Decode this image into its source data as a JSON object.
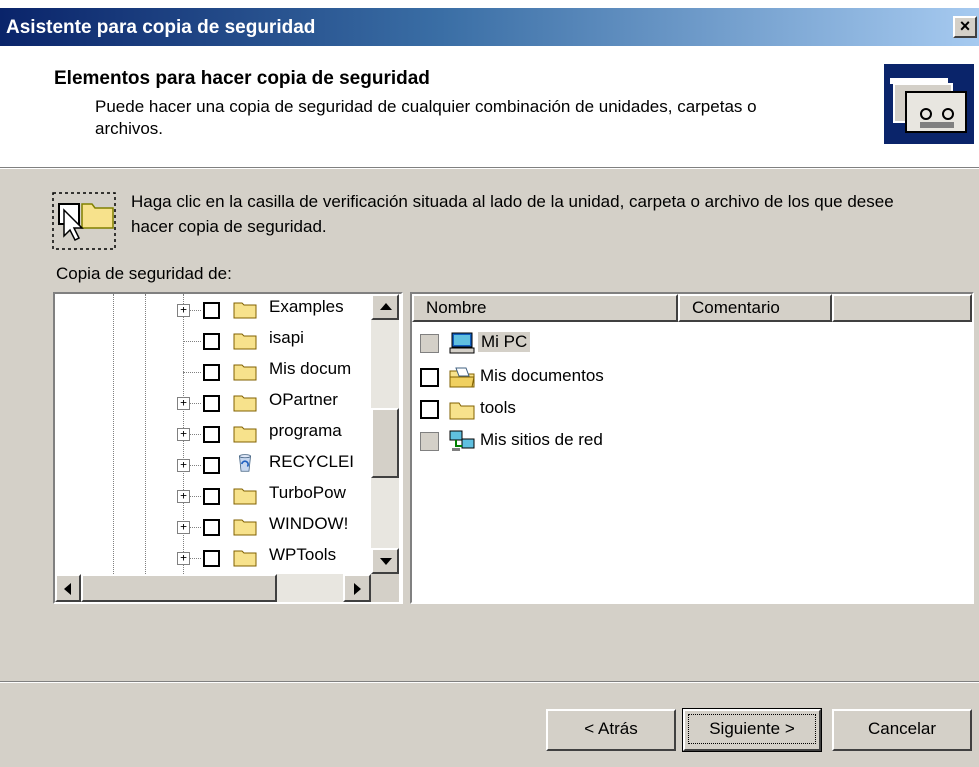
{
  "window": {
    "title": "Asistente para copia de seguridad",
    "close_label": "×"
  },
  "header": {
    "title": "Elementos para hacer copia de seguridad",
    "description": "Puede hacer una copia de seguridad de cualquier combinación de unidades, carpetas o archivos."
  },
  "instructions": "Haga clic en la casilla de verificación situada al lado de la unidad, carpeta o archivo de los que desee hacer copia de seguridad.",
  "backup_from_label": "Copia de seguridad de:",
  "tree": {
    "items": [
      {
        "label": "Examples",
        "expandable": true,
        "icon": "folder-icon",
        "checked": false
      },
      {
        "label": "isapi",
        "expandable": false,
        "icon": "folder-icon",
        "checked": false
      },
      {
        "label": "Mis docum",
        "expandable": false,
        "icon": "folder-icon",
        "checked": false
      },
      {
        "label": "OPartner",
        "expandable": true,
        "icon": "folder-icon",
        "checked": false
      },
      {
        "label": "programa",
        "expandable": true,
        "icon": "folder-icon",
        "checked": false
      },
      {
        "label": "RECYCLEI",
        "expandable": true,
        "icon": "recycle-bin-icon",
        "checked": false
      },
      {
        "label": "TurboPow",
        "expandable": true,
        "icon": "folder-icon",
        "checked": false
      },
      {
        "label": "WINDOW!",
        "expandable": true,
        "icon": "folder-icon",
        "checked": false
      },
      {
        "label": "WPTools",
        "expandable": true,
        "icon": "folder-icon",
        "checked": false
      }
    ]
  },
  "list": {
    "columns": [
      "Nombre",
      "Comentario",
      ""
    ],
    "rows": [
      {
        "name": "Mi PC",
        "icon": "computer-icon",
        "check_state": "disabled",
        "selected": true
      },
      {
        "name": "Mis documentos",
        "icon": "my-documents-icon",
        "check_state": "unchecked",
        "selected": false
      },
      {
        "name": "tools",
        "icon": "folder-icon",
        "check_state": "unchecked",
        "selected": false
      },
      {
        "name": "Mis sitios de red",
        "icon": "network-places-icon",
        "check_state": "disabled",
        "selected": false
      }
    ]
  },
  "buttons": {
    "back": "< Atrás",
    "next": "Siguiente >",
    "cancel": "Cancelar"
  },
  "colors": {
    "titlebar_start": "#0a246a",
    "titlebar_end": "#a6caf0",
    "dialog_face": "#d4d0c8",
    "folder": "#f7e28c"
  }
}
